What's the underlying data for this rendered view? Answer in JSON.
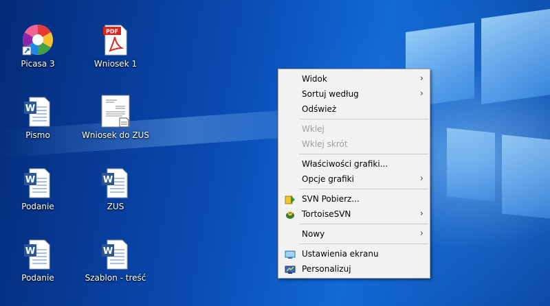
{
  "desktop": {
    "icons": [
      {
        "label": "Picasa 3",
        "icon": "picasa-icon"
      },
      {
        "label": "Wniosek 1",
        "icon": "pdf-file-icon",
        "badge": "PDF"
      },
      {
        "label": "Pismo",
        "icon": "word-doc-icon",
        "badge": "W"
      },
      {
        "label": "Wniosek do ZUS",
        "icon": "document-thumbnail-icon"
      },
      {
        "label": "Podanie",
        "icon": "word-doc-icon",
        "badge": "W"
      },
      {
        "label": "ZUS",
        "icon": "word-doc-icon",
        "badge": "W"
      },
      {
        "label": "Podanie",
        "icon": "word-doc-icon",
        "badge": "W"
      },
      {
        "label": "Szablon - treść",
        "icon": "word-doc-icon",
        "badge": "W"
      }
    ]
  },
  "context_menu": {
    "view": "Widok",
    "sort_by": "Sortuj według",
    "refresh": "Odśwież",
    "paste": "Wklej",
    "paste_shortcut": "Wklej skrót",
    "graphics_properties": "Właściwości grafiki...",
    "graphics_options": "Opcje grafiki",
    "svn_checkout": "SVN Pobierz...",
    "tortoise_svn": "TortoiseSVN",
    "new": "Nowy",
    "display_settings": "Ustawienia ekranu",
    "personalize": "Personalizuj",
    "submenu_arrow": "›"
  },
  "colors": {
    "menu_bg": "#f2f2f2",
    "disabled_text": "#9d9d9d",
    "word_blue": "#2b5797",
    "pdf_red": "#d9251c"
  }
}
